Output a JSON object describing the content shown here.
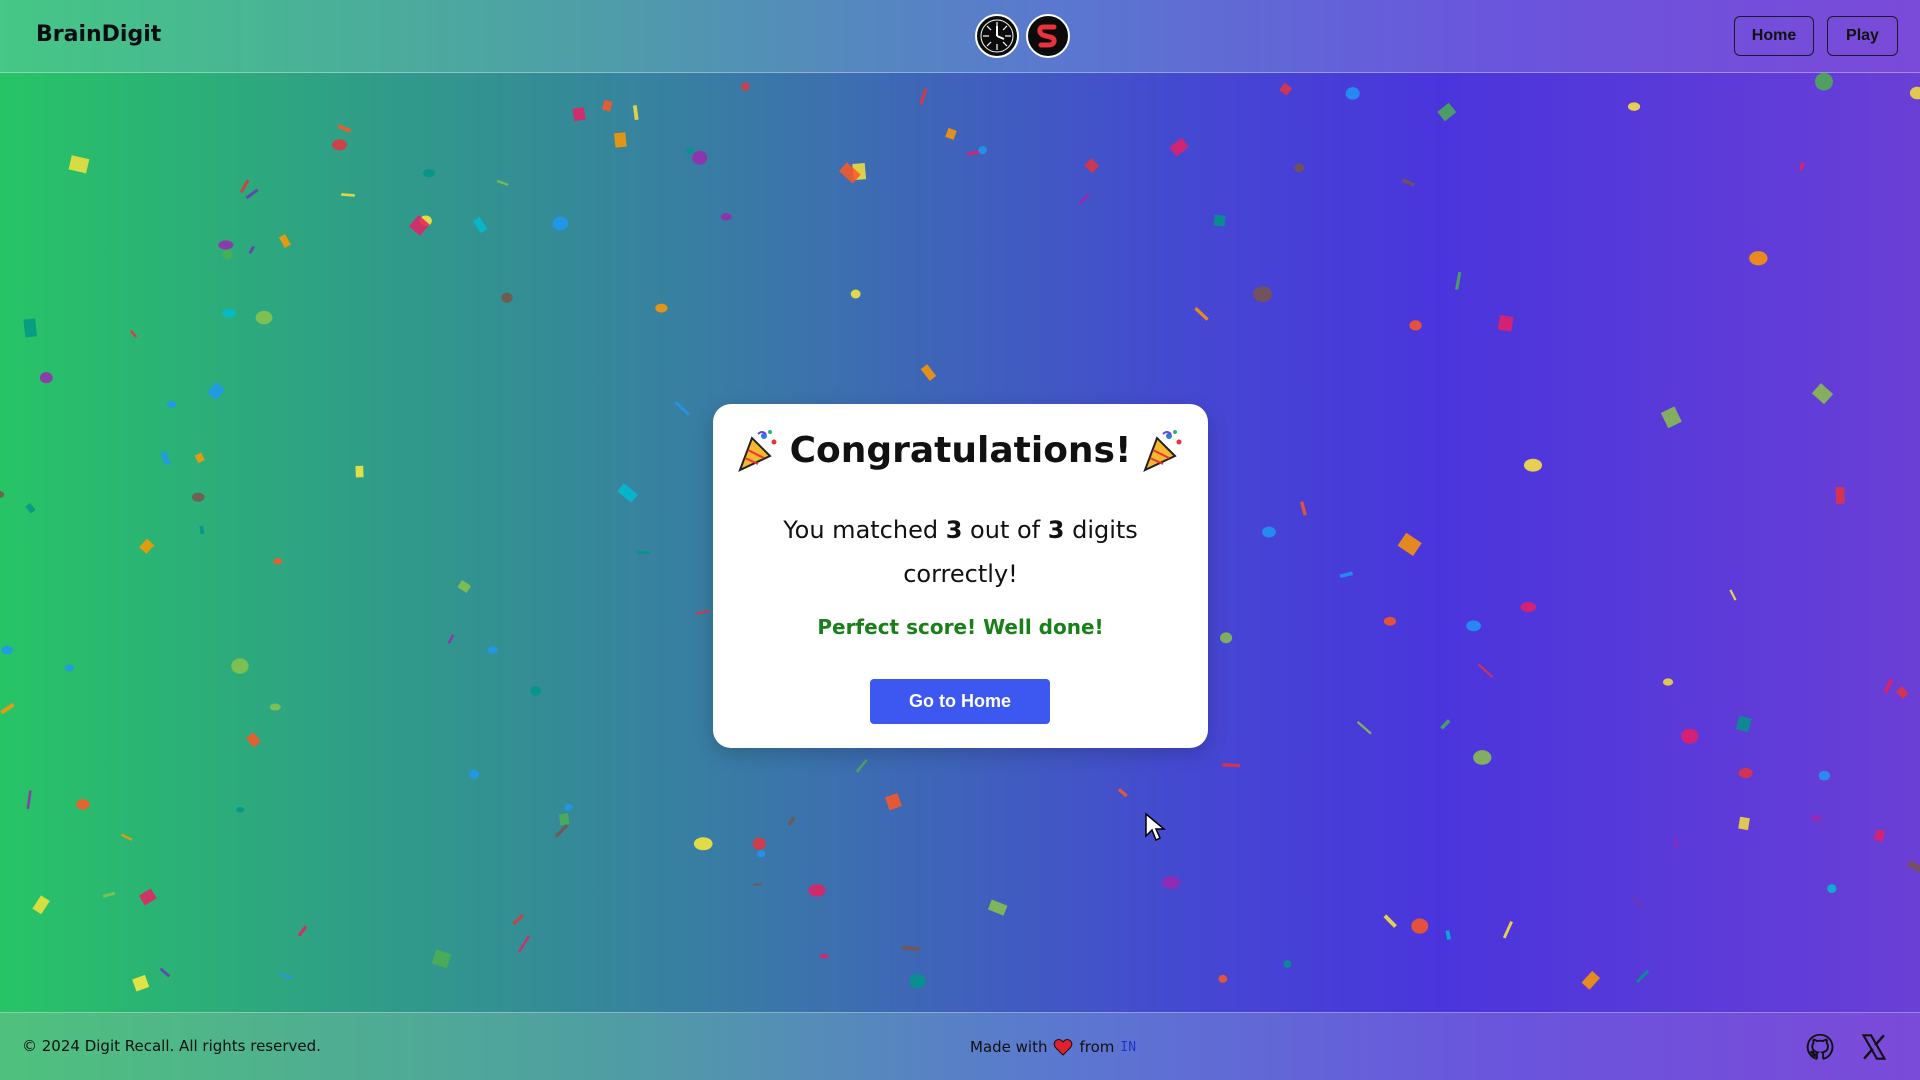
{
  "header": {
    "brand": "BrainDigit",
    "logos": [
      "clock-logo-icon",
      "s-logo-icon"
    ],
    "nav": {
      "home_label": "Home",
      "play_label": "Play"
    }
  },
  "card": {
    "title": "Congratulations!",
    "message_prefix": "You matched ",
    "matched": "3",
    "message_middle": " out of ",
    "total": "3",
    "message_suffix": " digits correctly!",
    "score_text": "Perfect score! Well done!",
    "button_label": "Go to Home"
  },
  "footer": {
    "copyright": "© 2024 Digit Recall. All rights reserved.",
    "made_with": "Made with",
    "from": "from",
    "country": "IN",
    "social": [
      "github-icon",
      "x-icon"
    ]
  },
  "colors": {
    "accent_button": "#3c58f0",
    "success_text": "#198019",
    "heart": "#e0202a"
  }
}
